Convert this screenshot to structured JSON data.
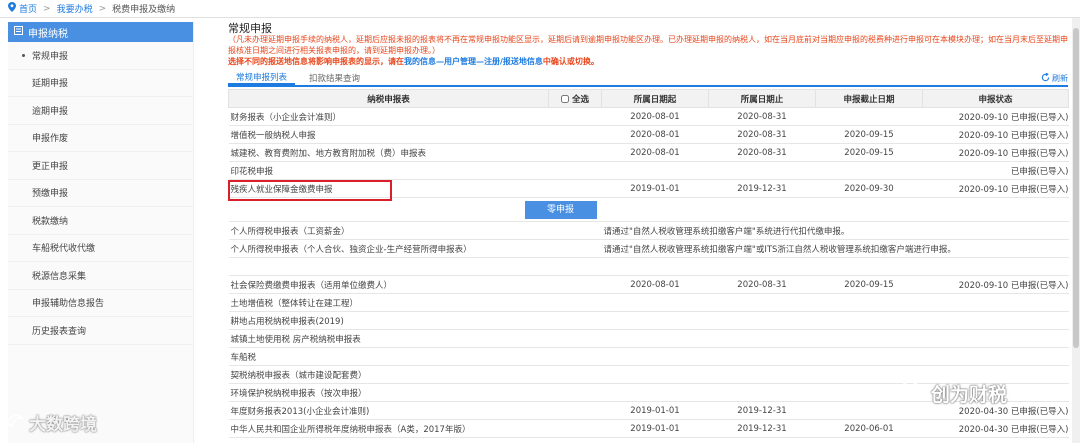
{
  "breadcrumb": {
    "home": "首页",
    "level1": "我要办税",
    "level2": "税费申报及缴纳"
  },
  "sidebar": {
    "header": "申报纳税",
    "items": [
      {
        "label": "常规申报"
      },
      {
        "label": "延期申报"
      },
      {
        "label": "逾期申报"
      },
      {
        "label": "申报作废"
      },
      {
        "label": "更正申报"
      },
      {
        "label": "预缴申报"
      },
      {
        "label": "税款缴纳"
      },
      {
        "label": "车船税代收代缴"
      },
      {
        "label": "税源信息采集"
      },
      {
        "label": "申报辅助信息报告"
      },
      {
        "label": "历史报表查询"
      }
    ]
  },
  "main": {
    "title": "常规申报",
    "note1": "（凡未办理延期申报手续的纳税人，延期后应报未报的报表将不再在常规申报功能区显示，延期后请到逾期申报功能区办理。已办理延期申报的纳税人，如在当月底前对当期应申报的税费种进行申报可在本模块办理；如在当月末后至延期申报核准日期之间进行相关报表申报的，请到延期申报办理。）",
    "note2_prefix": "选择不同的报送地信息将影响申报表的显示，请在",
    "note2_link": "我的信息—用户管理—注册/报送地信息",
    "note2_suffix": "中确认或切换。",
    "tabs": [
      {
        "label": "常规申报列表"
      },
      {
        "label": "扣款结果查询"
      }
    ],
    "refresh": "刷新",
    "table": {
      "headers": [
        "纳税申报表",
        "全选",
        "所属日期起",
        "所属日期止",
        "申报截止日期",
        "申报状态"
      ],
      "rows": [
        [
          "财务报表（小企业会计准则）",
          "",
          "2020-08-01",
          "2020-08-31",
          "",
          "2020-09-10 已申报(已导入)"
        ],
        [
          "增值税一般纳税人申报",
          "",
          "2020-08-01",
          "2020-08-31",
          "2020-09-15",
          "2020-09-10 已申报(已导入)"
        ],
        [
          "城建税、教育费附加、地方教育附加税（费）申报表",
          "",
          "2020-08-01",
          "2020-08-31",
          "2020-09-15",
          "2020-09-10 已申报(已导入)"
        ],
        [
          "印花税申报",
          "",
          "",
          "",
          "",
          "已申报(已导入)"
        ],
        [
          "残疾人就业保障金缴费申报",
          "",
          "2019-01-01",
          "2019-12-31",
          "2020-09-30",
          "2020-09-10 已申报(已导入)"
        ]
      ],
      "zero_button": "零申报",
      "rows2": [
        {
          "name": "个人所得税申报表（工资薪金）",
          "msg": "请通过\"自然人税收管理系统扣缴客户端\"系统进行代扣代缴申报。"
        },
        {
          "name": "个人所得税申报表（个人合伙、独资企业-生产经营所得申报表）",
          "msg": "请通过\"自然人税收管理系统扣缴客户端\"或ITS浙江自然人税收管理系统扣缴客户端进行申报。"
        }
      ],
      "rows3": [
        [
          "社会保险费缴费申报表（适用单位缴费人）",
          "",
          "2020-08-01",
          "2020-08-31",
          "2020-09-15",
          "2020-09-10 已申报(已导入)"
        ],
        [
          "土地增值税（整体转让在建工程）",
          "",
          "",
          "",
          "",
          ""
        ],
        [
          "耕地占用税纳税申报表(2019)",
          "",
          "",
          "",
          "",
          ""
        ],
        [
          "城镇土地使用税 房产税纳税申报表",
          "",
          "",
          "",
          "",
          ""
        ],
        [
          "车船税",
          "",
          "",
          "",
          "",
          ""
        ],
        [
          "契税纳税申报表（城市建设配套费）",
          "",
          "",
          "",
          "",
          ""
        ],
        [
          "环境保护税纳税申报表（按次申报）",
          "",
          "",
          "",
          "",
          ""
        ],
        [
          "年度财务报表2013(小企业会计准则)",
          "",
          "2019-01-01",
          "2019-12-31",
          "",
          "2020-04-30 已申报(已导入)"
        ],
        [
          "中华人民共和国企业所得税年度纳税申报表（A类，2017年版）",
          "",
          "2019-01-01",
          "2019-12-31",
          "2020-06-01",
          "2020-04-30 已申报(已导入)"
        ]
      ]
    }
  },
  "watermarks": {
    "left": "大数跨境",
    "right": "创为财税"
  }
}
